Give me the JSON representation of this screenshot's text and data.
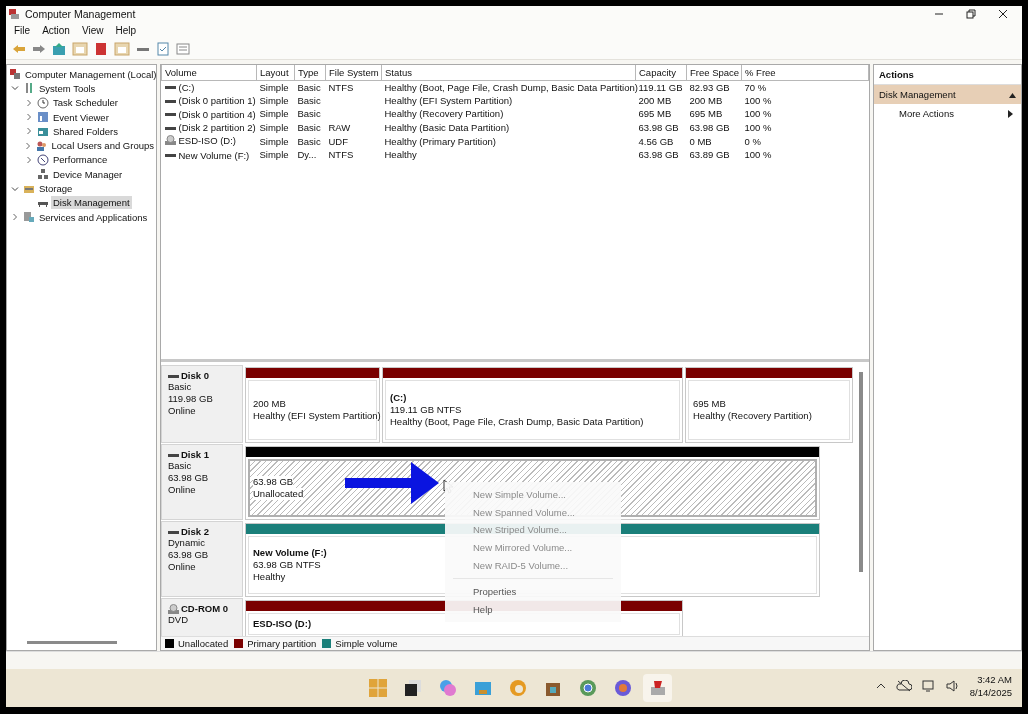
{
  "window": {
    "title": "Computer Management"
  },
  "menu": [
    "File",
    "Action",
    "View",
    "Help"
  ],
  "tree": [
    {
      "label": "Computer Management (Local)",
      "selected": false,
      "children": [
        {
          "label": "System Tools",
          "expanded": true,
          "selected": false,
          "children": [
            {
              "label": "Task Scheduler",
              "expanded": false,
              "selected": false
            },
            {
              "label": "Event Viewer",
              "expanded": false,
              "selected": false
            },
            {
              "label": "Shared Folders",
              "expanded": false,
              "selected": false
            },
            {
              "label": "Local Users and Groups",
              "expanded": false,
              "selected": false
            },
            {
              "label": "Performance",
              "expanded": false,
              "selected": false
            },
            {
              "label": "Device Manager",
              "selected": false
            }
          ]
        },
        {
          "label": "Storage",
          "expanded": true,
          "selected": false,
          "children": [
            {
              "label": "Disk Management",
              "selected": true
            }
          ]
        },
        {
          "label": "Services and Applications",
          "expanded": false,
          "selected": false
        }
      ]
    }
  ],
  "volume_table": {
    "columns": [
      "Volume",
      "Layout",
      "Type",
      "File System",
      "Status",
      "Capacity",
      "Free Space",
      "% Free"
    ],
    "rows": [
      {
        "kind": "disk",
        "cells": [
          "(C:)",
          "Simple",
          "Basic",
          "NTFS",
          "Healthy (Boot, Page File, Crash Dump, Basic Data Partition)",
          "119.11 GB",
          "82.93 GB",
          "70 %"
        ]
      },
      {
        "kind": "disk",
        "cells": [
          "(Disk 0 partition 1)",
          "Simple",
          "Basic",
          "",
          "Healthy (EFI System Partition)",
          "200 MB",
          "200 MB",
          "100 %"
        ]
      },
      {
        "kind": "disk",
        "cells": [
          "(Disk 0 partition 4)",
          "Simple",
          "Basic",
          "",
          "Healthy (Recovery Partition)",
          "695 MB",
          "695 MB",
          "100 %"
        ]
      },
      {
        "kind": "disk",
        "cells": [
          "(Disk 2 partition 2)",
          "Simple",
          "Basic",
          "RAW",
          "Healthy (Basic Data Partition)",
          "63.98 GB",
          "63.98 GB",
          "100 %"
        ]
      },
      {
        "kind": "optical",
        "cells": [
          "ESD-ISO (D:)",
          "Simple",
          "Basic",
          "UDF",
          "Healthy (Primary Partition)",
          "4.56 GB",
          "0 MB",
          "0 %"
        ]
      },
      {
        "kind": "disk",
        "cells": [
          "New Volume (F:)",
          "Simple",
          "Dy...",
          "NTFS",
          "Healthy",
          "63.98 GB",
          "63.89 GB",
          "100 %"
        ]
      }
    ]
  },
  "disks": [
    {
      "kind": "disk",
      "name": "Disk 0",
      "lines": [
        "Basic",
        "119.98 GB",
        "Online"
      ],
      "partitions": [
        {
          "kind": "primary",
          "selected": false,
          "lines": [
            "200 MB",
            "Healthy (EFI System Partition)"
          ]
        },
        {
          "kind": "primary",
          "selected": false,
          "name": "(C:)",
          "lines": [
            "119.11 GB NTFS",
            "Healthy (Boot, Page File, Crash Dump, Basic Data Partition)"
          ]
        },
        {
          "kind": "primary",
          "selected": false,
          "lines": [
            "695 MB",
            "Healthy (Recovery Partition)"
          ]
        }
      ]
    },
    {
      "kind": "disk",
      "name": "Disk 1",
      "lines": [
        "Basic",
        "63.98 GB",
        "Online"
      ],
      "partitions": [
        {
          "kind": "unallocated",
          "selected": true,
          "lines": [
            "63.98 GB",
            "Unallocated"
          ]
        }
      ]
    },
    {
      "kind": "disk",
      "name": "Disk 2",
      "lines": [
        "Dynamic",
        "63.98 GB",
        "Online"
      ],
      "partitions": [
        {
          "kind": "simple",
          "selected": false,
          "name": "New Volume  (F:)",
          "lines": [
            "63.98 GB NTFS",
            "Healthy"
          ]
        }
      ]
    },
    {
      "kind": "optical",
      "name": "CD-ROM 0",
      "lines": [
        "DVD"
      ],
      "partitions": [
        {
          "kind": "primary",
          "selected": false,
          "name": "ESD-ISO  (D:)"
        }
      ]
    }
  ],
  "legend": [
    {
      "label": "Unallocated",
      "color": "#000000"
    },
    {
      "label": "Primary partition",
      "color": "#7a0000"
    },
    {
      "label": "Simple volume",
      "color": "#1a7f7a"
    }
  ],
  "context_menu": [
    {
      "kind": "item",
      "label": "New Simple Volume...",
      "disabled": true
    },
    {
      "kind": "item",
      "label": "New Spanned Volume...",
      "disabled": true
    },
    {
      "kind": "item",
      "label": "New Striped Volume...",
      "disabled": true
    },
    {
      "kind": "item",
      "label": "New Mirrored Volume...",
      "disabled": true
    },
    {
      "kind": "item",
      "label": "New RAID-5 Volume...",
      "disabled": true
    },
    {
      "kind": "separator"
    },
    {
      "kind": "item",
      "label": "Properties",
      "disabled": false
    },
    {
      "kind": "item",
      "label": "Help",
      "disabled": false
    }
  ],
  "actions": {
    "title": "Actions",
    "section": {
      "label": "Disk Management",
      "expanded": true
    },
    "items": [
      "More Actions"
    ]
  },
  "taskbar": {
    "time": "3:42 AM",
    "date": "8/14/2025"
  }
}
